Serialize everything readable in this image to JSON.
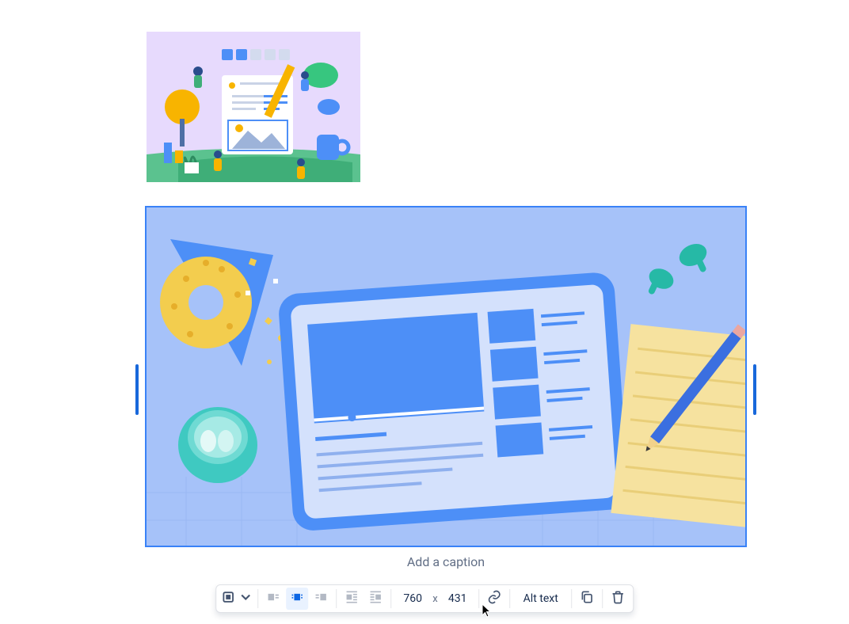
{
  "caption": {
    "placeholder": "Add a caption"
  },
  "toolbar": {
    "width": "760",
    "height": "431",
    "x_label": "x",
    "alt_text": "Alt text"
  },
  "icons": {
    "border_dropdown": "border-dropdown-icon",
    "align_left": "align-left-icon",
    "align_center": "align-center-icon",
    "align_right": "align-right-icon",
    "wrap_left": "wrap-left-icon",
    "wrap_right": "wrap-right-icon",
    "link": "link-icon",
    "copy": "copy-icon",
    "trash": "trash-icon",
    "chevron_down": "chevron-down-icon"
  }
}
